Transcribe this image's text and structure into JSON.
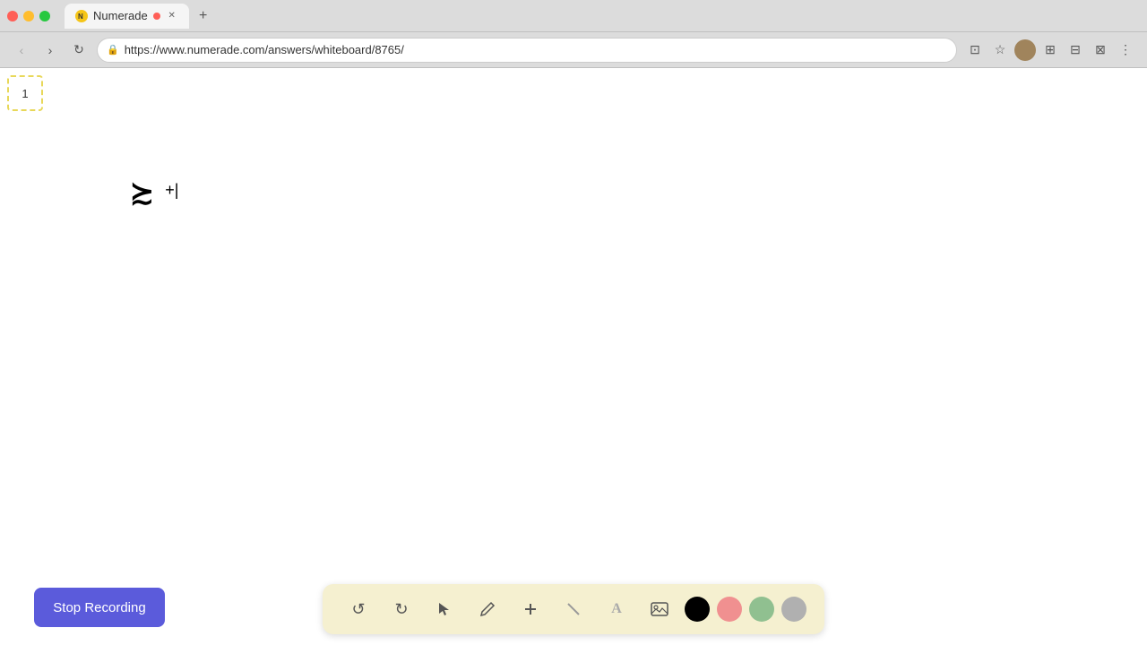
{
  "browser": {
    "tab": {
      "title": "Numerade",
      "url": "https://www.numerade.com/answers/whiteboard/8765/",
      "favicon": "N"
    },
    "controls": {
      "back": "‹",
      "forward": "›",
      "refresh": "↻",
      "lock": "🔒",
      "bookmark": "☆",
      "extensions": "⚙",
      "menu": "⋮"
    }
  },
  "page": {
    "page_number": "1",
    "whiteboard": {
      "symbol": "≿",
      "cursor": "+"
    }
  },
  "toolbar": {
    "undo_label": "↺",
    "redo_label": "↻",
    "select_label": "▶",
    "pen_label": "✏",
    "add_label": "+",
    "eraser_label": "╱",
    "text_label": "A",
    "image_label": "🖼",
    "colors": [
      "#000000",
      "#f09090",
      "#90c090",
      "#b0b0b0"
    ]
  },
  "stop_recording": {
    "label": "Stop Recording",
    "bg_color": "#5b5bdb"
  }
}
